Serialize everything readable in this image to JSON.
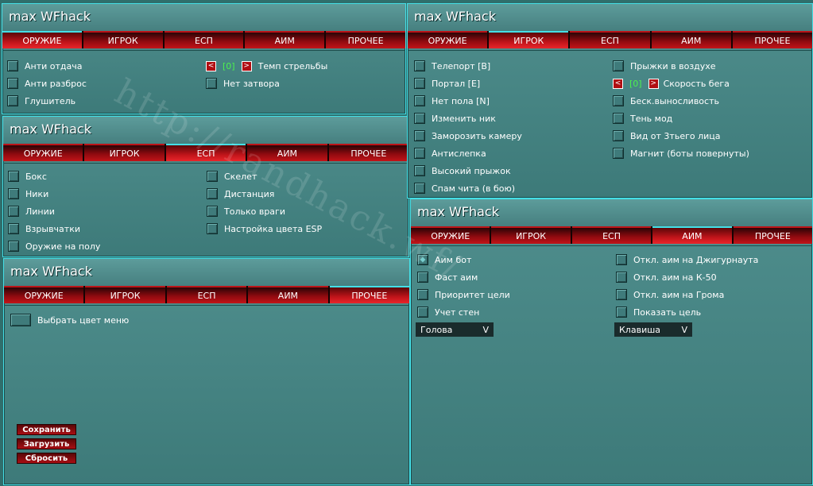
{
  "app_title": "max WFhack",
  "tabs": [
    "ОРУЖИЕ",
    "ИГРОК",
    "ЕСП",
    "АИМ",
    "ПРОЧЕЕ"
  ],
  "weapon_window": {
    "title": "max WFhack",
    "active_tab": "ОРУЖИЕ",
    "left_options": [
      "Анти отдача",
      "Анти разброс",
      "Глушитель"
    ],
    "fire_rate": {
      "prev": "<",
      "value": "[0]",
      "next": ">",
      "label": "Темп стрельбы"
    },
    "no_bolt": "Нет затвора"
  },
  "esp_window": {
    "title": "max WFhack",
    "active_tab": "ЕСП",
    "left_options": [
      "Бокс",
      "Ники",
      "Линии",
      "Взрывчатки",
      "Оружие на полу"
    ],
    "right_options": [
      "Скелет",
      "Дистанция",
      "Только враги",
      "Настройка цвета ESP"
    ]
  },
  "misc_window": {
    "title": "max WFhack",
    "active_tab": "ПРОЧЕЕ",
    "menu_color": "Выбрать цвет меню",
    "buttons": {
      "save": "Сохранить",
      "load": "Загрузить",
      "reset": "Сбросить"
    }
  },
  "player_window": {
    "title": "max WFhack",
    "active_tab": "ИГРОК",
    "left_options": [
      "Телепорт [B]",
      "Портал [E]",
      "Нет пола [N]",
      "Изменить ник",
      "Заморозить камеру",
      "Антислепка",
      "Высокий прыжок",
      "Спам чита (в бою)"
    ],
    "air_jump": "Прыжки в воздухе",
    "run_speed": {
      "prev": "<",
      "value": "[0]",
      "next": ">",
      "label": "Скорость бега"
    },
    "right_options": [
      "Беск.выносливость",
      "Тень мод",
      "Вид от 3тьего лица",
      "Магнит (боты повернуты)"
    ]
  },
  "aim_window": {
    "title": "max WFhack",
    "active_tab": "АИМ",
    "left_options": [
      "Аим бот",
      "Фаст аим",
      "Приоритет цели",
      "Учет стен"
    ],
    "right_options": [
      "Откл. аим на Джигурнаута",
      "Откл. аим на К-50",
      "Откл. аим на Грома",
      "Показать цель"
    ],
    "target_dropdown": {
      "value": "Голова",
      "arrow": "V"
    },
    "key_dropdown": {
      "value": "Клавиша",
      "arrow": "V"
    }
  },
  "watermark": "http://randhack.wf/"
}
